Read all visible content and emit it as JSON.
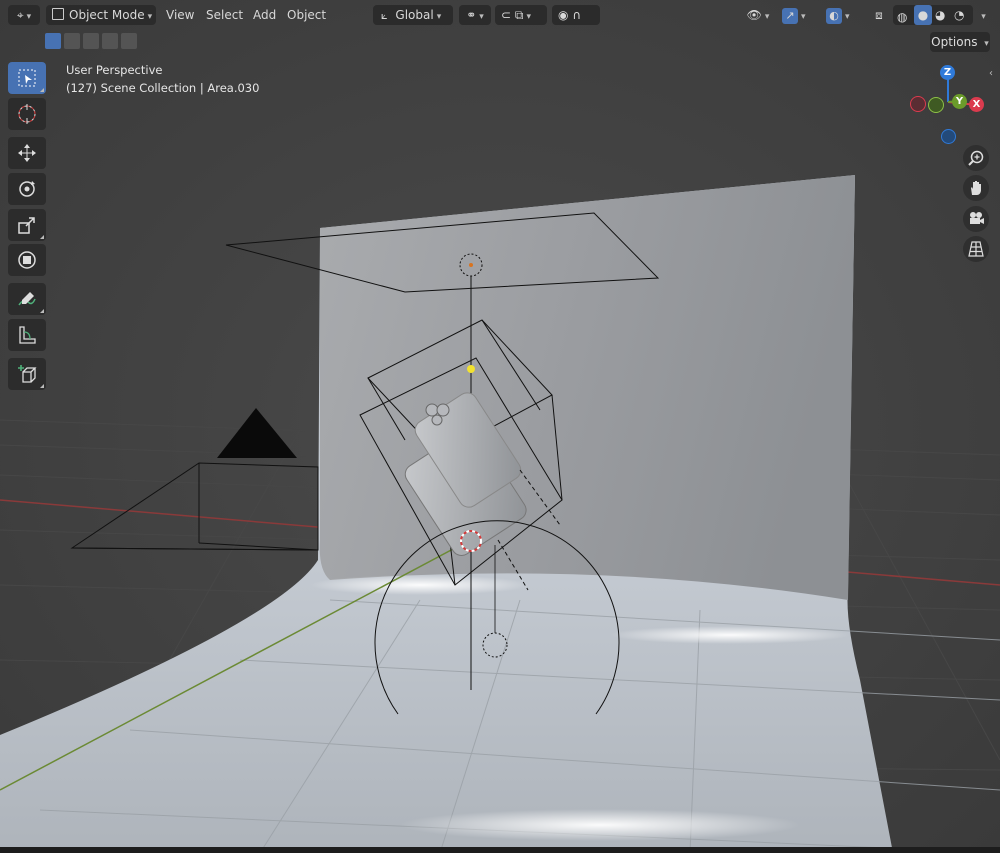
{
  "header": {
    "mode_label": "Object Mode",
    "menus": [
      "View",
      "Select",
      "Add",
      "Object"
    ],
    "orientation_label": "Global",
    "options_label": "Options",
    "editor_icon": "editor-type-icon",
    "accent_color": "#4772b3"
  },
  "viewport": {
    "perspective_label": "User Perspective",
    "collection_label": "(127) Scene Collection | Area.030"
  },
  "toolbar": {
    "tools": [
      "select-box",
      "cursor",
      "move",
      "rotate",
      "scale",
      "transform",
      "annotate",
      "measure",
      "add-cube"
    ],
    "active_tool": "select-box"
  },
  "gizmo": {
    "axes": {
      "x": "X",
      "y": "Y",
      "z": "Z"
    },
    "colors": {
      "x": "#db3b4e",
      "y": "#6b9b2b",
      "z": "#2f7ad9"
    }
  },
  "navigation": [
    "zoom-icon",
    "hand-pan-icon",
    "camera-icon",
    "grid-perspective-icon"
  ]
}
